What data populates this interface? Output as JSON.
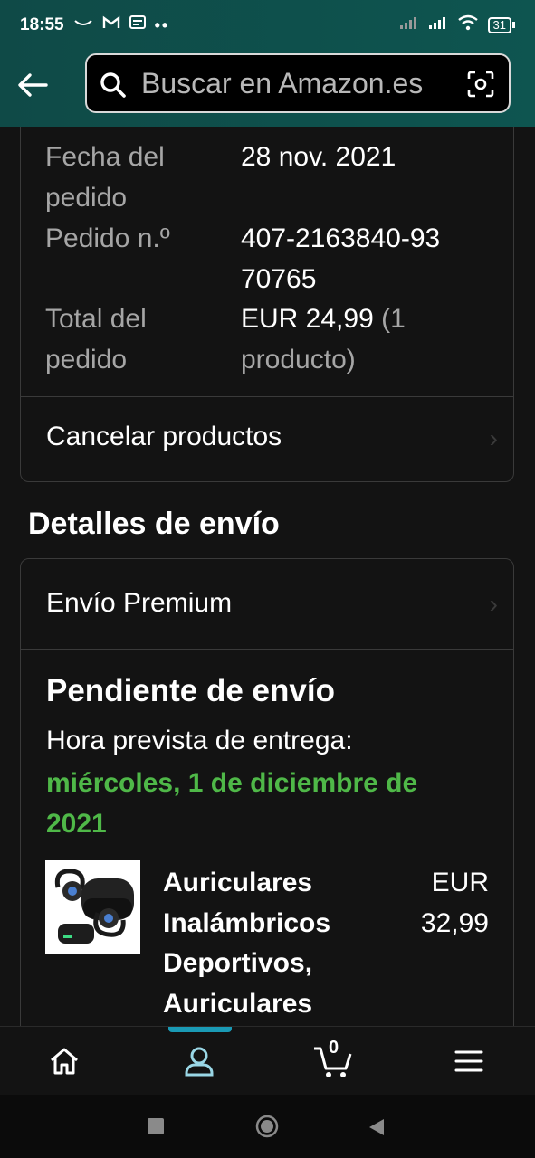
{
  "status_bar": {
    "time": "18:55",
    "battery": "31"
  },
  "search": {
    "placeholder": "Buscar en Amazon.es"
  },
  "order_summary": {
    "rows": [
      {
        "label": "Fecha del pedido",
        "value": "28 nov. 2021"
      },
      {
        "label": "Pedido n.º",
        "value": "407-2163840-9370765"
      },
      {
        "label": "Total del pedido",
        "value_main": "EUR 24,99",
        "value_dim": "(1 producto)"
      }
    ],
    "cancel_label": "Cancelar productos"
  },
  "shipping": {
    "section_title": "Detalles de envío",
    "method": "Envío Premium",
    "status_title": "Pendiente de envío",
    "delivery_label": "Hora prevista de entrega:",
    "delivery_date": "miércoles, 1 de diciembre de 2021",
    "item": {
      "name": "Auriculares Inalámbricos Deportivos, Auriculares",
      "price": "EUR 32,99"
    }
  },
  "bottom_nav": {
    "cart_count": "0"
  },
  "colors": {
    "accent_green": "#4fb848",
    "header_teal": "#0e5550",
    "nav_indicator": "#1a9ab5"
  }
}
